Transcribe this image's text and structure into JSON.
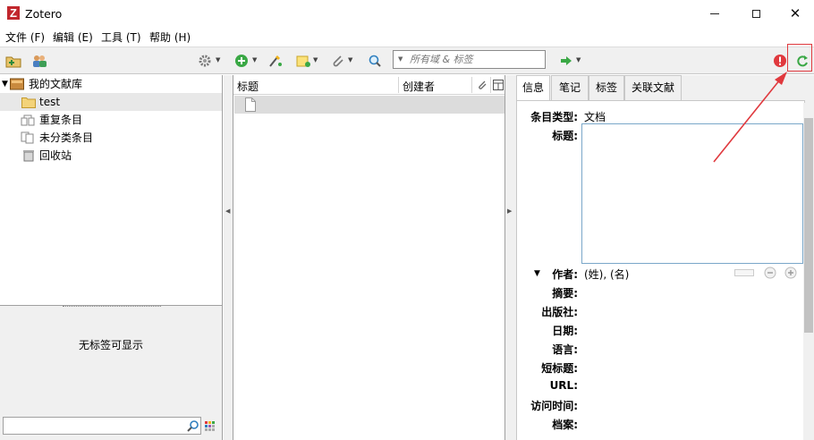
{
  "window": {
    "title": "Zotero",
    "logo_letter": "Z"
  },
  "menu": [
    "文件 (F)",
    "编辑 (E)",
    "工具 (T)",
    "帮助 (H)"
  ],
  "toolbar": {
    "search_placeholder": "所有域 & 标签"
  },
  "collections": [
    {
      "label": "我的文献库",
      "icon": "library-icon"
    },
    {
      "label": "test",
      "icon": "folder-icon",
      "selected": true
    },
    {
      "label": "重复条目",
      "icon": "duplicate-icon"
    },
    {
      "label": "未分类条目",
      "icon": "unfiled-icon"
    },
    {
      "label": "回收站",
      "icon": "trash-icon"
    }
  ],
  "tag_selector": {
    "empty_message": "无标签可显示"
  },
  "items_table": {
    "columns": [
      "标题",
      "创建者"
    ]
  },
  "item_pane": {
    "tabs": [
      "信息",
      "笔记",
      "标签",
      "关联文献"
    ],
    "fields": [
      {
        "label": "条目类型:",
        "value": "文档"
      },
      {
        "label": "标题:",
        "value": ""
      },
      {
        "label": "作者:",
        "value": "(姓), (名)"
      },
      {
        "label": "摘要:",
        "value": ""
      },
      {
        "label": "出版社:",
        "value": ""
      },
      {
        "label": "日期:",
        "value": ""
      },
      {
        "label": "语言:",
        "value": ""
      },
      {
        "label": "短标题:",
        "value": ""
      },
      {
        "label": "URL:",
        "value": ""
      },
      {
        "label": "访问时间:",
        "value": ""
      },
      {
        "label": "档案:",
        "value": ""
      }
    ]
  },
  "colors": {
    "accent_red": "#e0393e",
    "selection": "#dcdcdc",
    "panel_bg": "#f0f0f0",
    "brand_red": "#c1272d"
  }
}
